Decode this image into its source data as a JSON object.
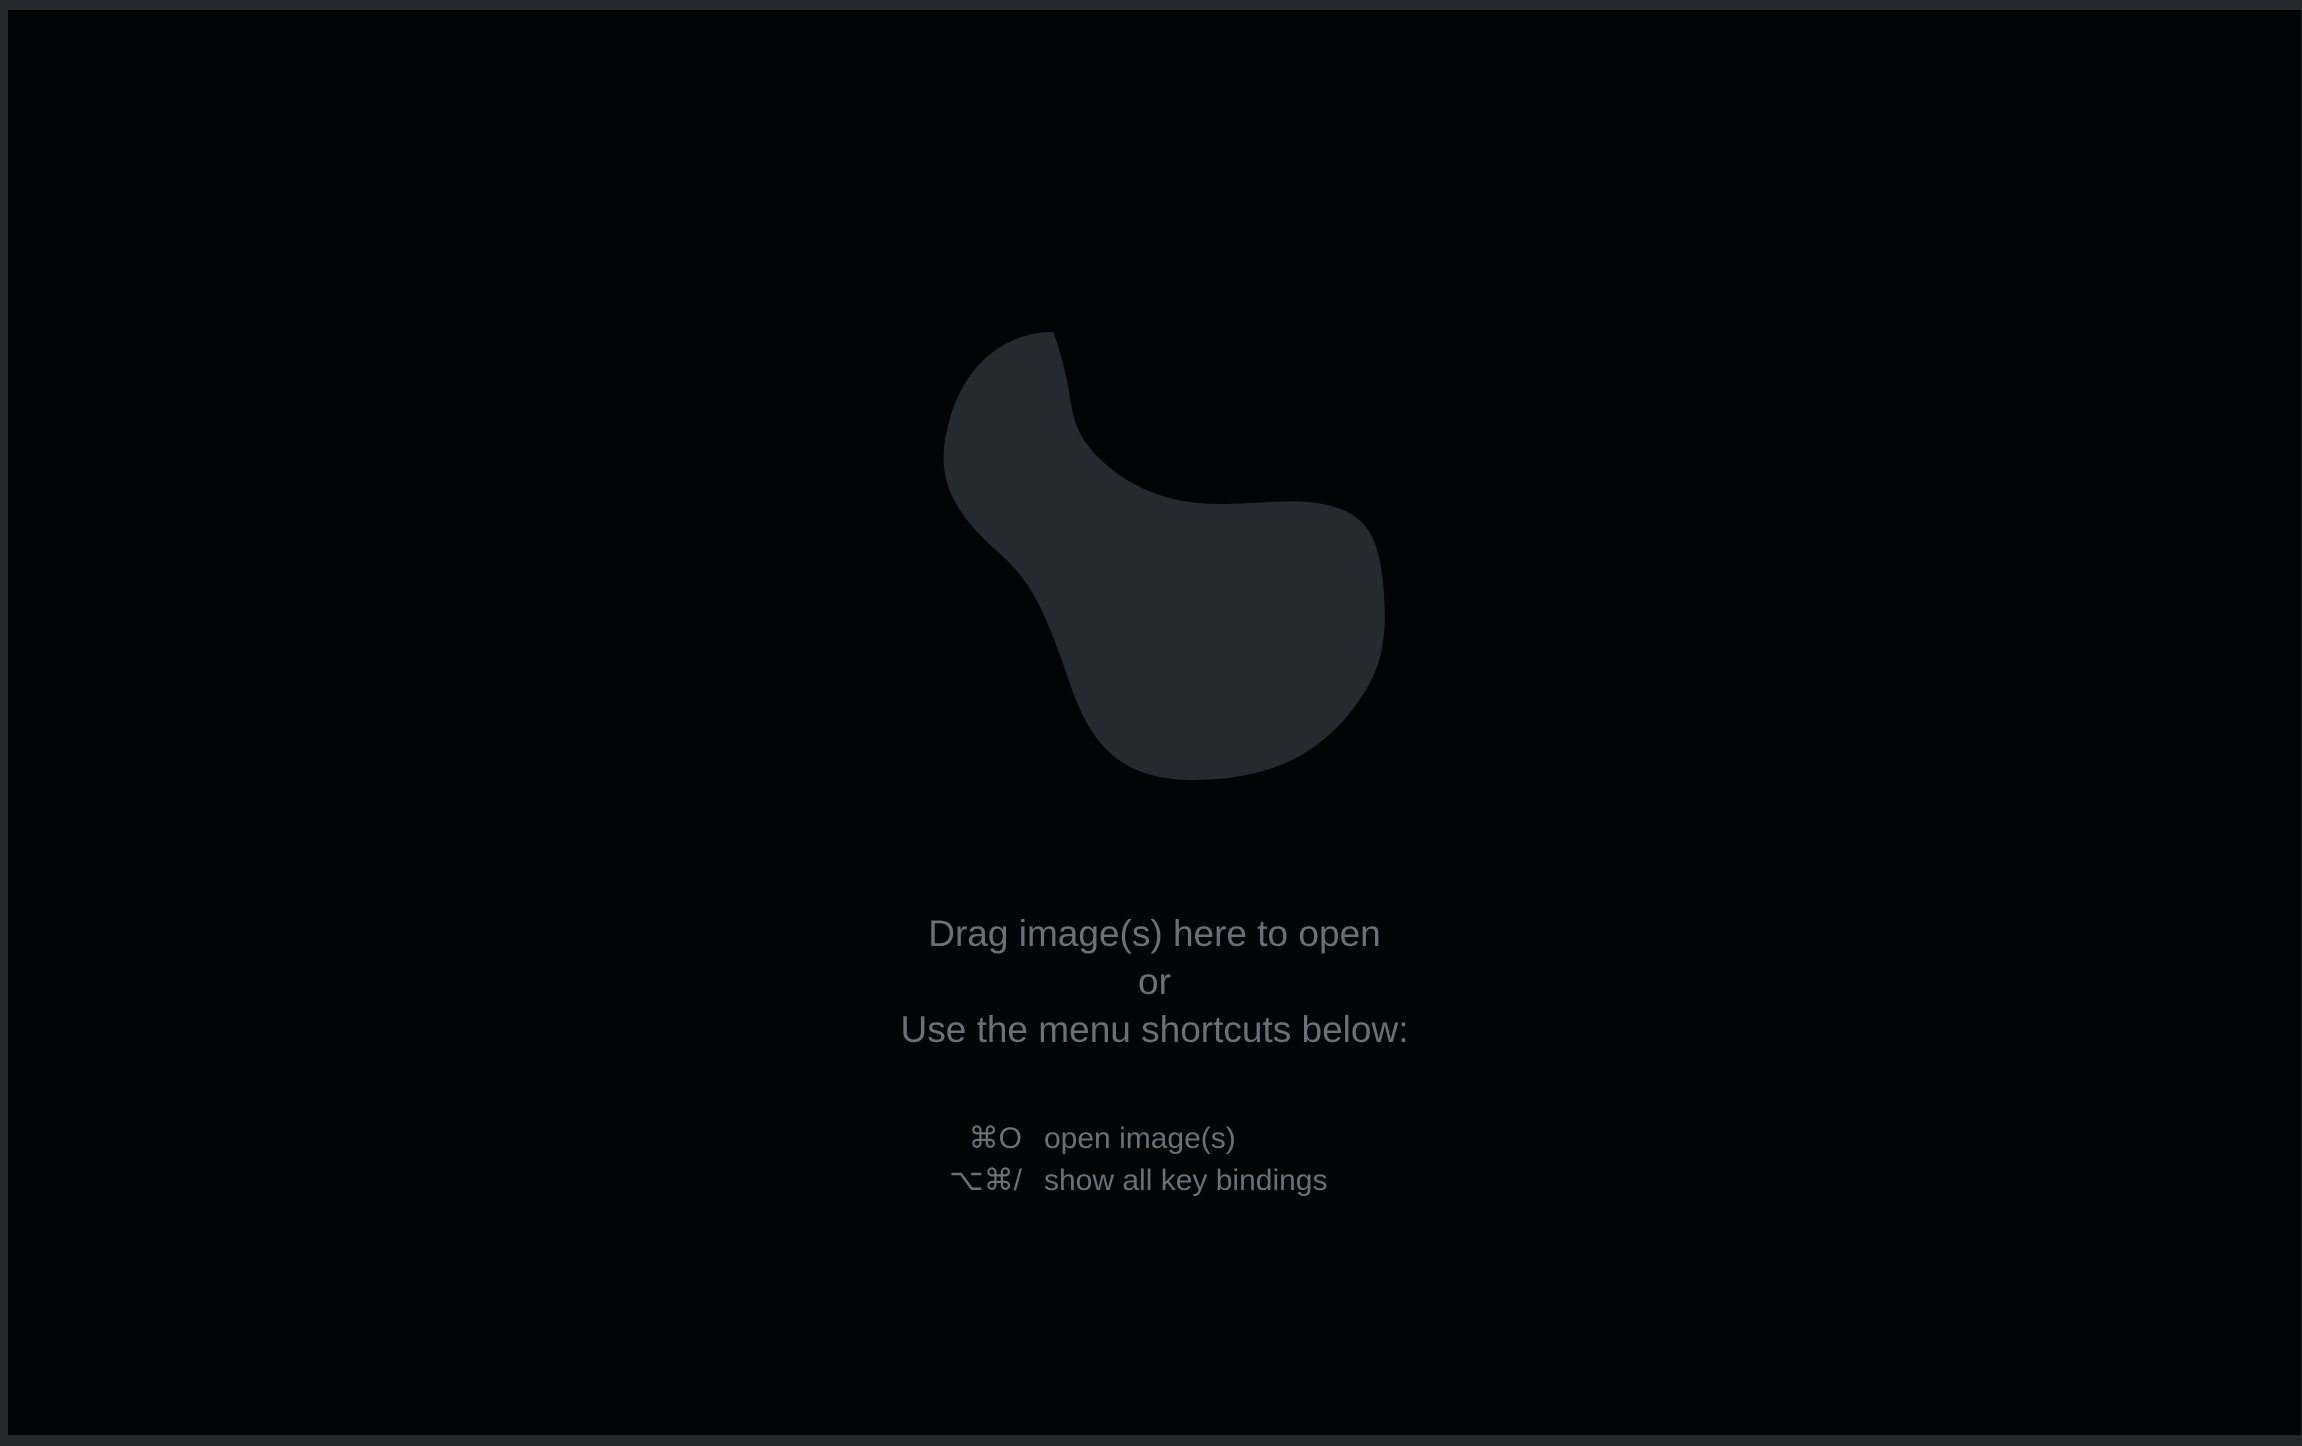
{
  "empty_state": {
    "line1": "Drag image(s) here to open",
    "line2": "or",
    "line3": "Use the menu shortcuts below:"
  },
  "shortcuts": [
    {
      "keys": "⌘O",
      "label": "open image(s)"
    },
    {
      "keys": "⌥⌘/",
      "label": "show all key bindings"
    }
  ],
  "colors": {
    "background": "#020304",
    "frame": "#26282d",
    "logo": "#26292f",
    "text": "#6c6f77"
  },
  "icons": {
    "logo": "app-logo-blob"
  }
}
